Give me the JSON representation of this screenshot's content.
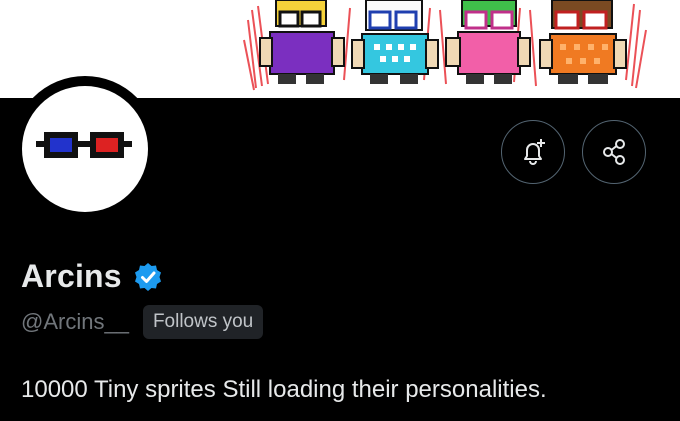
{
  "profile": {
    "name": "Arcins",
    "handle": "@Arcins__",
    "follows_badge": "Follows you",
    "bio": "10000 Tiny sprites Still loading their personalities."
  },
  "actions": [
    {
      "name": "notification-bell-add",
      "icon": "bell-plus-icon"
    },
    {
      "name": "share",
      "icon": "share-nodes-icon"
    }
  ],
  "banner": {
    "sprites": [
      {
        "hair": "yellow",
        "shirt": "purple",
        "glasses": "black"
      },
      {
        "hair": "white",
        "shirt": "cyan",
        "glasses": "blue"
      },
      {
        "hair": "green",
        "shirt": "pink",
        "glasses": "pink"
      },
      {
        "hair": "brown",
        "shirt": "orange",
        "glasses": "red"
      }
    ]
  },
  "colors": {
    "background": "#000000",
    "verified": "#1d9bf0",
    "name_text": "#e7e9ea",
    "handle_text": "#71767b",
    "badge_bg": "#202327"
  }
}
